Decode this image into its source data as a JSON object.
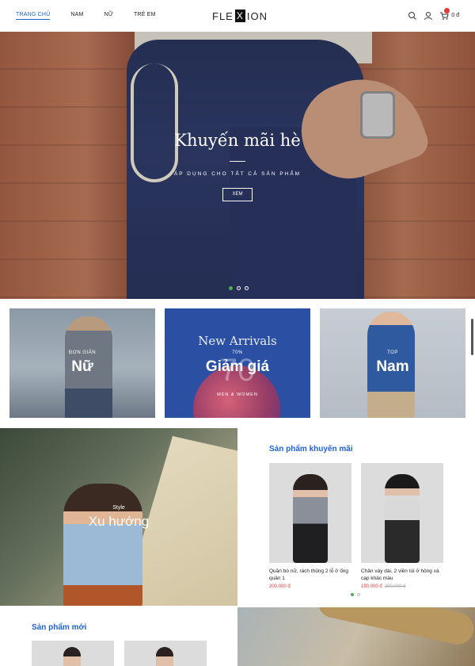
{
  "header": {
    "nav": [
      {
        "label": "TRANG CHỦ",
        "active": true
      },
      {
        "label": "NAM",
        "active": false
      },
      {
        "label": "NỮ",
        "active": false
      },
      {
        "label": "TRẺ EM",
        "active": false
      }
    ],
    "logo": {
      "left": "FLE",
      "mark": "X",
      "right": "ION"
    },
    "icons": [
      "search-icon",
      "user-icon",
      "cart-icon"
    ],
    "cart_total": "0 đ"
  },
  "hero": {
    "title": "Khuyến mãi hè",
    "subtitle": "ÁP DỤNG CHO TẤT CẢ SẢN PHẨM",
    "button": "XEM",
    "slides": 3,
    "active_slide": 1
  },
  "categories": [
    {
      "small": "ĐƠN GIẢN",
      "label": "Nữ"
    },
    {
      "heading": "New Arrivals",
      "small": "70%",
      "label": "Giảm giá",
      "big": "70",
      "sub": "MEN & WOMEN"
    },
    {
      "small": "TOP",
      "label": "Nam"
    }
  ],
  "trend": {
    "small": "Style",
    "label": "Xu hướng"
  },
  "promo": {
    "title": "Sản phẩm khuyến mãi",
    "products": [
      {
        "name": "Quần bò nữ, rách thủng 2 lỗ ở ống quần 1",
        "price": "200,000 đ",
        "old_price": ""
      },
      {
        "name": "Chân váy dài, 2 viền túi ở hông và cạp khác màu",
        "price": "190,000 đ",
        "old_price": "200,000 đ"
      }
    ],
    "pages": 2,
    "active_page": 1
  },
  "new_products": {
    "title": "Sản phẩm mới"
  },
  "colors": {
    "accent": "#1f62d6",
    "sale": "#e53935",
    "active_dot": "#4caf50"
  }
}
